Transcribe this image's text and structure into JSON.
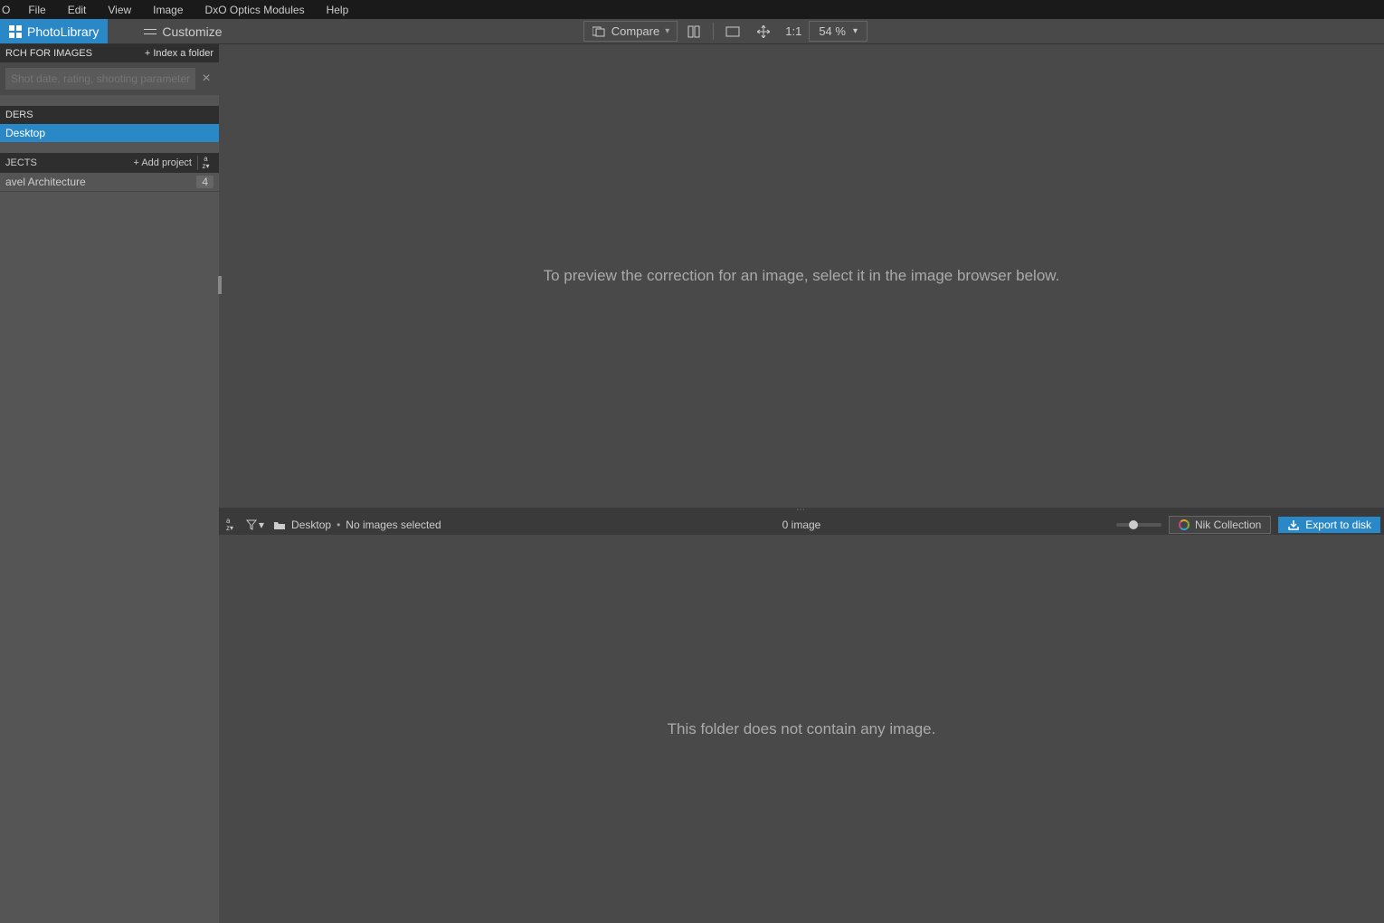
{
  "menubar": {
    "logo": "O",
    "items": [
      "File",
      "Edit",
      "View",
      "Image",
      "DxO Optics Modules",
      "Help"
    ]
  },
  "toolbar": {
    "tabs": {
      "photolibrary": "PhotoLibrary",
      "customize": "Customize"
    },
    "compare": "Compare",
    "ratio_label": "1:1",
    "zoom_value": "54 %"
  },
  "sidebar": {
    "search": {
      "title": "RCH FOR IMAGES",
      "index_action": "+ Index a folder",
      "placeholder": "Shot date, rating, shooting parameters..."
    },
    "folders": {
      "title": "DERS",
      "item": "Desktop"
    },
    "projects": {
      "title": "JECTS",
      "add_action": "+ Add project",
      "sort_glyph": "a↓z",
      "items": [
        {
          "name": "avel Architecture",
          "count": "4"
        }
      ]
    }
  },
  "preview": {
    "empty_text": "To preview the correction for an image, select it in the image browser below."
  },
  "browser_bar": {
    "sort_glyph": "a↓z",
    "location": "Desktop",
    "selection_status": "No images selected",
    "count_label": "0 image",
    "nik_label": "Nik Collection",
    "export_label": "Export to disk"
  },
  "browser": {
    "empty_text": "This folder does not contain any image."
  }
}
